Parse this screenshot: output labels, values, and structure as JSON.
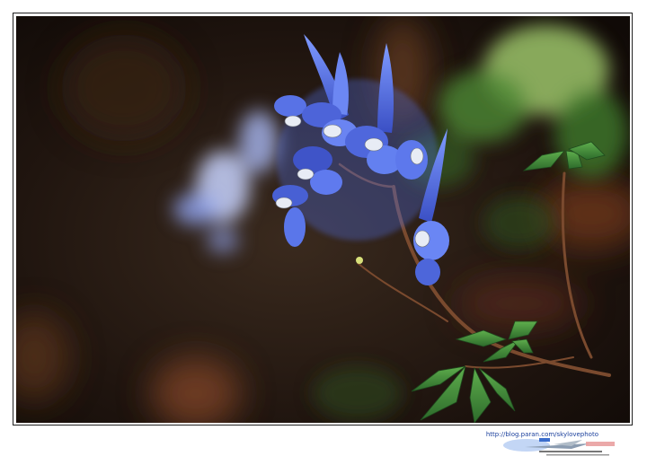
{
  "photo": {
    "subject": "blue-corydalis-flowers-icon"
  },
  "watermark": {
    "url": "http://blog.paran.com/skylovephoto"
  },
  "colors": {
    "background": "#ffffff",
    "border": "#222222",
    "petal": "#5a78e6",
    "leaf": "#3f8a3a"
  }
}
